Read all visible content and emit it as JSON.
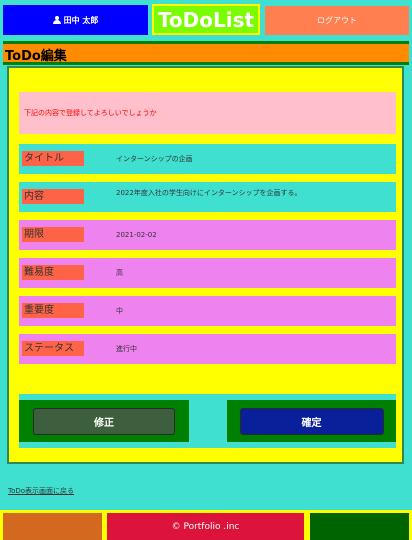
{
  "header": {
    "user_name": "田中 太郎",
    "app_title": "ToDoList",
    "logout_label": "ログアウト"
  },
  "page": {
    "section_title": "ToDo編集",
    "confirm_message": "下記の内容で登録してよろしいでしょうか"
  },
  "fields": [
    {
      "label": "タイトル",
      "value": "インターンシップの企画"
    },
    {
      "label": "内容",
      "value": "2022年度入社の学生向けにインターンシップを企画する。"
    },
    {
      "label": "期限",
      "value": "2021-02-02"
    },
    {
      "label": "難易度",
      "value": "高"
    },
    {
      "label": "重要度",
      "value": "中"
    },
    {
      "label": "ステータス",
      "value": "進行中"
    }
  ],
  "actions": {
    "edit_label": "修正",
    "confirm_label": "確定"
  },
  "back_link": "ToDo表示画面に戻る",
  "footer": {
    "copyright": "© Portfolio .inc"
  },
  "colors": {
    "background": "#40e0d0",
    "user_box": "#0000ff",
    "title_box": "#7cfc00",
    "logout": "#ff7f50",
    "card": "#ffff00",
    "label": "#ff6347",
    "confirm_btn": "#0a1f9a"
  }
}
